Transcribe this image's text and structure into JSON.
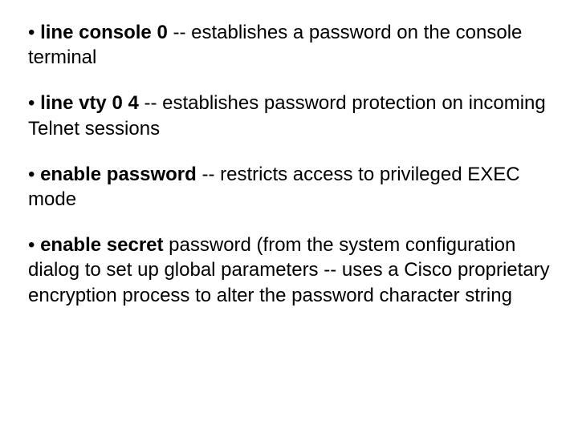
{
  "items": [
    {
      "bullet": " • ",
      "bold": "line console 0",
      "rest": " -- establishes a password on the console terminal"
    },
    {
      "bullet": " • ",
      "bold": "line vty 0 4",
      "rest": " -- establishes password protection on incoming Telnet sessions"
    },
    {
      "bullet": " • ",
      "bold": "enable password",
      "rest": " -- restricts access to privileged EXEC mode"
    },
    {
      "bullet": " • ",
      "bold": "enable secret",
      "rest": " password (from the system configuration dialog to set up global parameters -- uses a Cisco proprietary encryption process to alter the password character string"
    }
  ]
}
